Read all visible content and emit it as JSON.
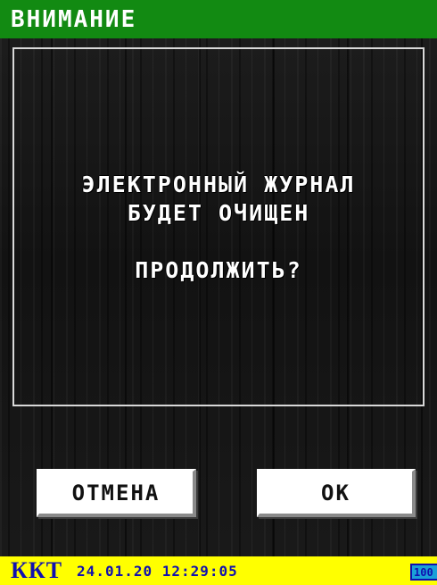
{
  "dialog": {
    "title": "ВНИМАНИЕ",
    "message_lines": [
      "ЭЛЕКТРОННЫЙ ЖУРНАЛ",
      "БУДЕТ ОЧИЩЕН",
      "ПРОДОЛЖИТЬ?"
    ],
    "cancel_label": "ОТМЕНА",
    "ok_label": "ОК"
  },
  "status_bar": {
    "device_label": "ККТ",
    "datetime": "24.01.20 12:29:05",
    "battery_level": "100"
  },
  "colors": {
    "title_bar": "#128a12",
    "status_bar": "#ffff00",
    "status_text": "#1010b0",
    "battery_fill": "#1aa0d8",
    "background": "#151515"
  },
  "icons": {
    "battery": "battery-icon"
  }
}
